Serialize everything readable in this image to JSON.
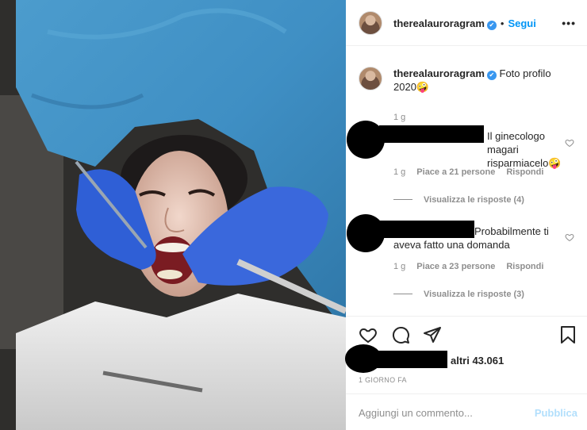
{
  "post": {
    "username": "therealauroragram",
    "verified_mark": "✔",
    "dot": "•",
    "follow_label": "Segui",
    "more_label": "•••"
  },
  "caption": {
    "username": "therealauroragram",
    "text": "Foto profilo 2020🤪",
    "time": "1 g"
  },
  "comments": [
    {
      "text": "Il ginecologo magari risparmiacelo🤪",
      "time": "1 g",
      "likes": "Piace a 21 persone",
      "reply_label": "Rispondi",
      "view_replies": "Visualizza le risposte (4)"
    },
    {
      "text": "Probabilmente ti aveva fatto una domanda",
      "time": "1 g",
      "likes": "Piace a 23 persone",
      "reply_label": "Rispondi",
      "view_replies": "Visualizza le risposte (3)"
    }
  ],
  "likes": {
    "text": "altri 43.061"
  },
  "timeago": "1 GIORNO FA",
  "add_comment": {
    "placeholder": "Aggiungi un commento...",
    "publish_label": "Pubblica"
  },
  "colors": {
    "accent": "#0095f6",
    "verified": "#3897f0",
    "publish_disabled": "#b2dffc",
    "meta_gray": "#8e8e8e",
    "gown_blue": "#3f8fc4",
    "glove_blue": "#2f5fd6"
  },
  "icons": {
    "heart": "heart-icon",
    "comment": "comment-icon",
    "share": "share-icon",
    "save": "bookmark-icon",
    "more": "more-options-icon"
  }
}
